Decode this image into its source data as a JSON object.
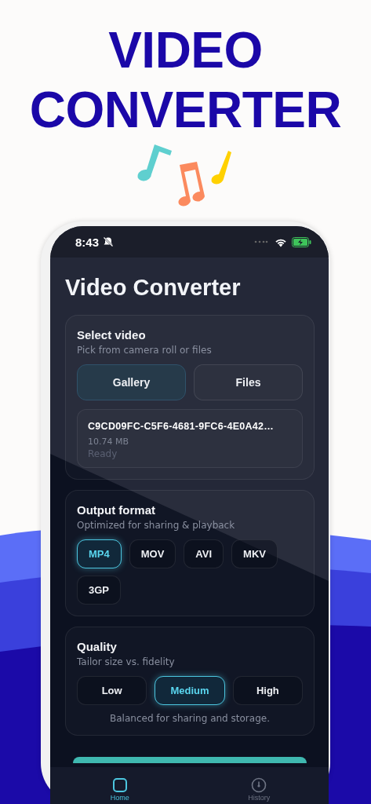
{
  "headline": [
    "VIDEO",
    "CONVERTER"
  ],
  "status_bar": {
    "time": "8:43"
  },
  "title": "Video Converter",
  "source_card": {
    "title": "Select video",
    "subtitle": "Pick from camera roll or files",
    "buttons": [
      {
        "label": "Gallery",
        "selected": true
      },
      {
        "label": "Files",
        "selected": false
      }
    ],
    "file": {
      "name": "C9CD09FC-C5F6-4681-9FC6-4E0A42…",
      "size": "10.74 MB",
      "status": "Ready"
    }
  },
  "format_card": {
    "title": "Output format",
    "subtitle": "Optimized for sharing & playback",
    "options": [
      {
        "label": "MP4",
        "selected": true
      },
      {
        "label": "MOV",
        "selected": false
      },
      {
        "label": "AVI",
        "selected": false
      },
      {
        "label": "MKV",
        "selected": false
      },
      {
        "label": "3GP",
        "selected": false
      }
    ]
  },
  "quality_card": {
    "title": "Quality",
    "subtitle": "Tailor size vs. fidelity",
    "options": [
      {
        "label": "Low",
        "selected": false
      },
      {
        "label": "Medium",
        "selected": true
      },
      {
        "label": "High",
        "selected": false
      }
    ],
    "note": "Balanced for sharing and storage."
  },
  "nav": [
    {
      "label": "Home",
      "kind": "home",
      "selected": true
    },
    {
      "label": "History",
      "kind": "history",
      "selected": false
    }
  ]
}
